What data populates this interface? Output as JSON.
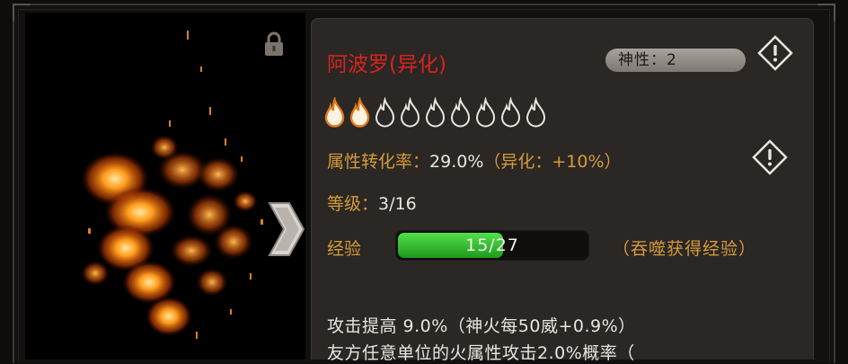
{
  "card": {
    "name": "阿波罗(异化)",
    "divinity_label": "神性：2",
    "flames": {
      "lit": 2,
      "total": 9
    },
    "attr_label": "属性转化率：",
    "attr_value": "29.0%",
    "attr_extra": "（异化：+10%）",
    "level_label": "等级：",
    "level_value": "3/16",
    "exp_label": "经验",
    "exp_text": "15/27",
    "exp_progress": 0.556,
    "devour_label": "（吞噬获得经验）",
    "desc_line1": "攻击提高 9.0%（神火每50威+0.9%）",
    "desc_line2": "友方任意单位的火属性攻击2.0%概率（"
  },
  "icons": {
    "lock": "lock-icon",
    "next": "chevron-right-icon",
    "info": "warning-diamond-icon",
    "flame": "flame-icon"
  },
  "colors": {
    "name": "#d8231d",
    "label": "#d59a3a",
    "value": "#e9e6e1",
    "bar": "#35c62f",
    "panel": "#2a2725"
  }
}
